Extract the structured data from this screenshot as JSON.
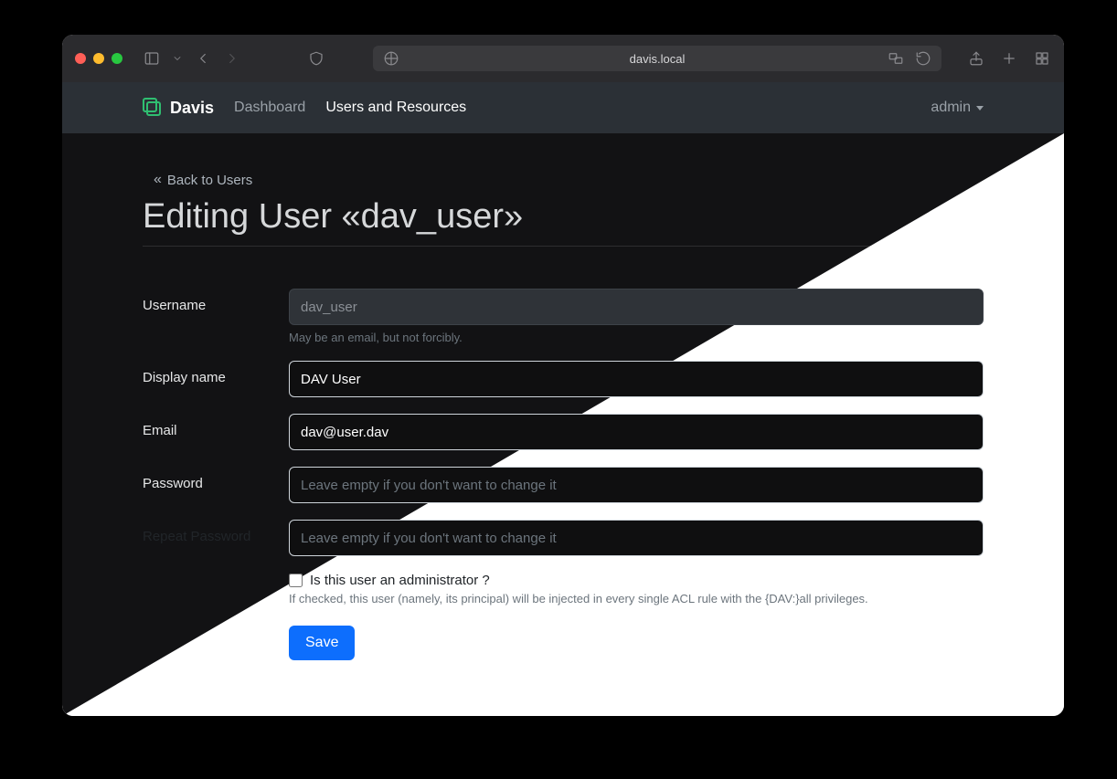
{
  "browser": {
    "url_display": "davis.local"
  },
  "nav": {
    "brand": "Davis",
    "dashboard": "Dashboard",
    "users_resources": "Users and Resources",
    "user_menu_label": "admin"
  },
  "page": {
    "back_link": "Back to Users",
    "title": "Editing User «dav_user»"
  },
  "form": {
    "username": {
      "label": "Username",
      "value": "dav_user",
      "help": "May be an email, but not forcibly."
    },
    "display_name": {
      "label": "Display name",
      "value": "DAV User"
    },
    "email": {
      "label": "Email",
      "value": "dav@user.dav"
    },
    "password": {
      "label": "Password",
      "placeholder": "Leave empty if you don't want to change it"
    },
    "repeat_password": {
      "label": "Repeat Password",
      "placeholder": "Leave empty if you don't want to change it"
    },
    "admin_check": {
      "label": "Is this user an administrator ?",
      "help": "If checked, this user (namely, its principal) will be injected in every single ACL rule with the {DAV:}all privileges."
    },
    "save_label": "Save"
  }
}
